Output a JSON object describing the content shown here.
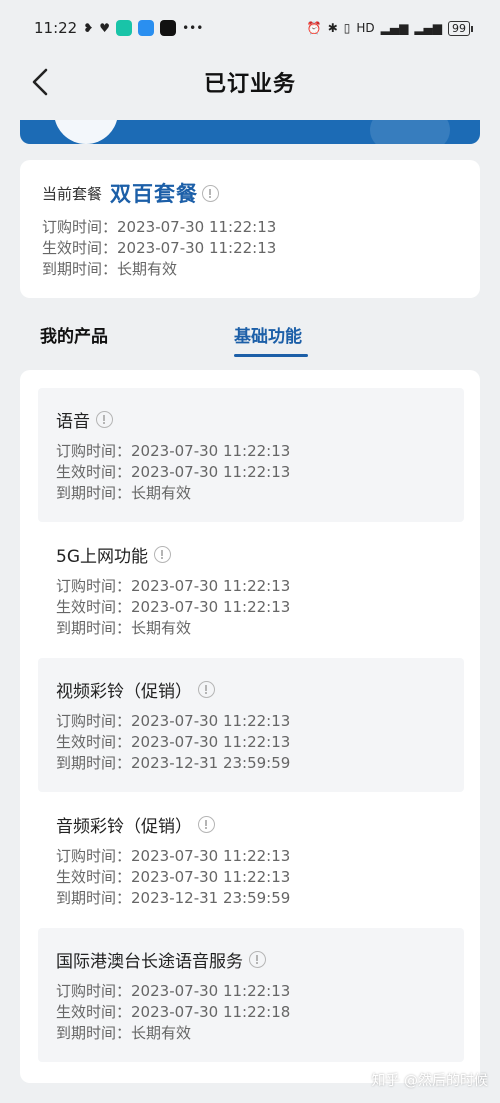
{
  "status_bar": {
    "time": "11:22",
    "battery": "99"
  },
  "header": {
    "title": "已订业务"
  },
  "plan": {
    "label": "当前套餐",
    "name": "双百套餐",
    "rows": [
      {
        "key": "订购时间：",
        "value": "2023-07-30 11:22:13"
      },
      {
        "key": "生效时间：",
        "value": "2023-07-30 11:22:13"
      },
      {
        "key": "到期时间：",
        "value": "长期有效"
      }
    ]
  },
  "tabs": {
    "products": "我的产品",
    "basic": "基础功能",
    "active": "basic"
  },
  "features": [
    {
      "title": "语音",
      "rows": [
        {
          "key": "订购时间：",
          "value": "2023-07-30 11:22:13"
        },
        {
          "key": "生效时间：",
          "value": "2023-07-30 11:22:13"
        },
        {
          "key": "到期时间：",
          "value": "长期有效"
        }
      ]
    },
    {
      "title": "5G上网功能",
      "rows": [
        {
          "key": "订购时间：",
          "value": "2023-07-30 11:22:13"
        },
        {
          "key": "生效时间：",
          "value": "2023-07-30 11:22:13"
        },
        {
          "key": "到期时间：",
          "value": "长期有效"
        }
      ]
    },
    {
      "title": "视频彩铃（促销）",
      "rows": [
        {
          "key": "订购时间：",
          "value": "2023-07-30 11:22:13"
        },
        {
          "key": "生效时间：",
          "value": "2023-07-30 11:22:13"
        },
        {
          "key": "到期时间：",
          "value": "2023-12-31 23:59:59"
        }
      ]
    },
    {
      "title": "音频彩铃（促销）",
      "rows": [
        {
          "key": "订购时间：",
          "value": "2023-07-30 11:22:13"
        },
        {
          "key": "生效时间：",
          "value": "2023-07-30 11:22:13"
        },
        {
          "key": "到期时间：",
          "value": "2023-12-31 23:59:59"
        }
      ]
    },
    {
      "title": "国际港澳台长途语音服务",
      "rows": [
        {
          "key": "订购时间：",
          "value": "2023-07-30 11:22:13"
        },
        {
          "key": "生效时间：",
          "value": "2023-07-30 11:22:18"
        },
        {
          "key": "到期时间：",
          "value": "长期有效"
        }
      ]
    }
  ],
  "watermark": "知乎 @然后的时候",
  "colors": {
    "accent": "#1c5fa8",
    "banner": "#1c6bb5",
    "background": "#eef0f2"
  }
}
